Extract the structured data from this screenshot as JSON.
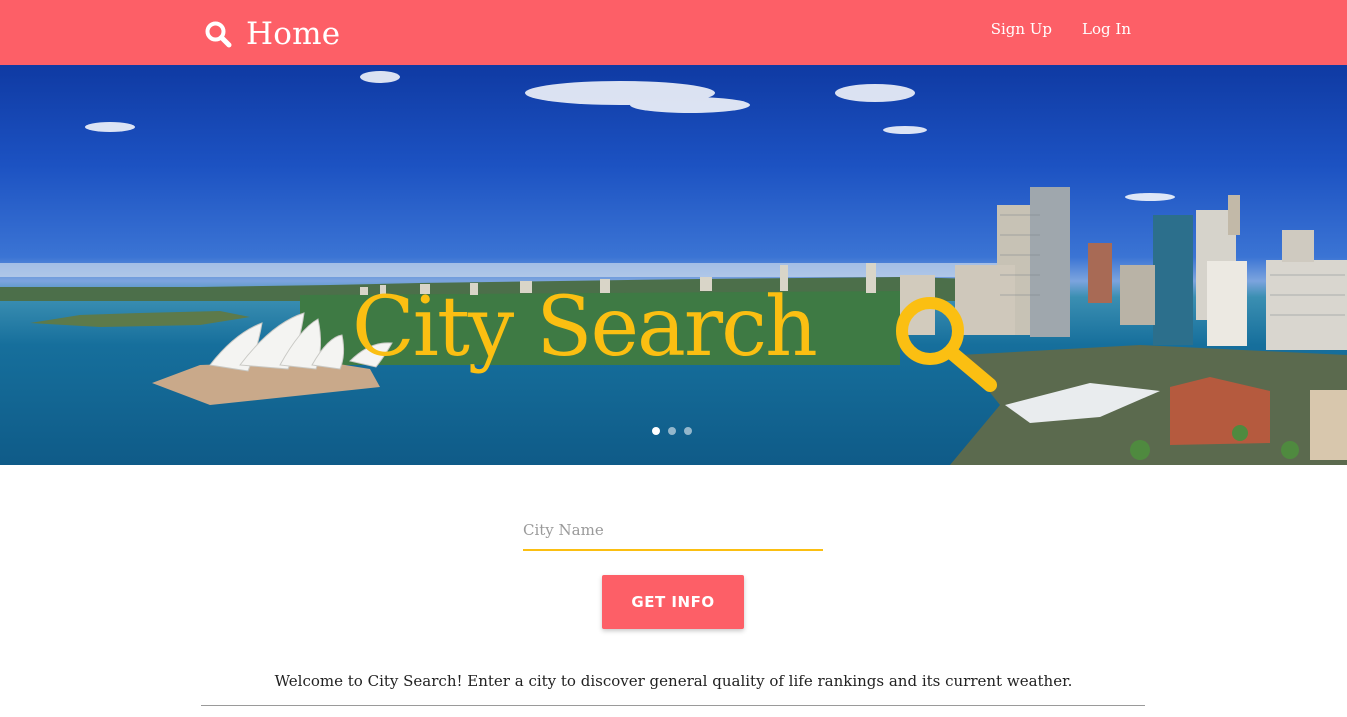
{
  "navbar": {
    "brand_label": "Home",
    "brand_icon": "search-icon",
    "links": [
      {
        "label": "Sign Up"
      },
      {
        "label": "Log In"
      }
    ],
    "background_color": "#fd5f67"
  },
  "hero": {
    "title": "City Search",
    "title_icon": "magnifier-icon",
    "title_color": "#fbbf12",
    "carousel": {
      "slide_count": 3,
      "active_index": 0
    }
  },
  "search_form": {
    "city_placeholder": "City Name",
    "city_value": "",
    "submit_label": "GET INFO",
    "accent_color": "#fbbf12"
  },
  "welcome_text": "Welcome to City Search! Enter a city to discover general quality of life rankings and its current weather."
}
